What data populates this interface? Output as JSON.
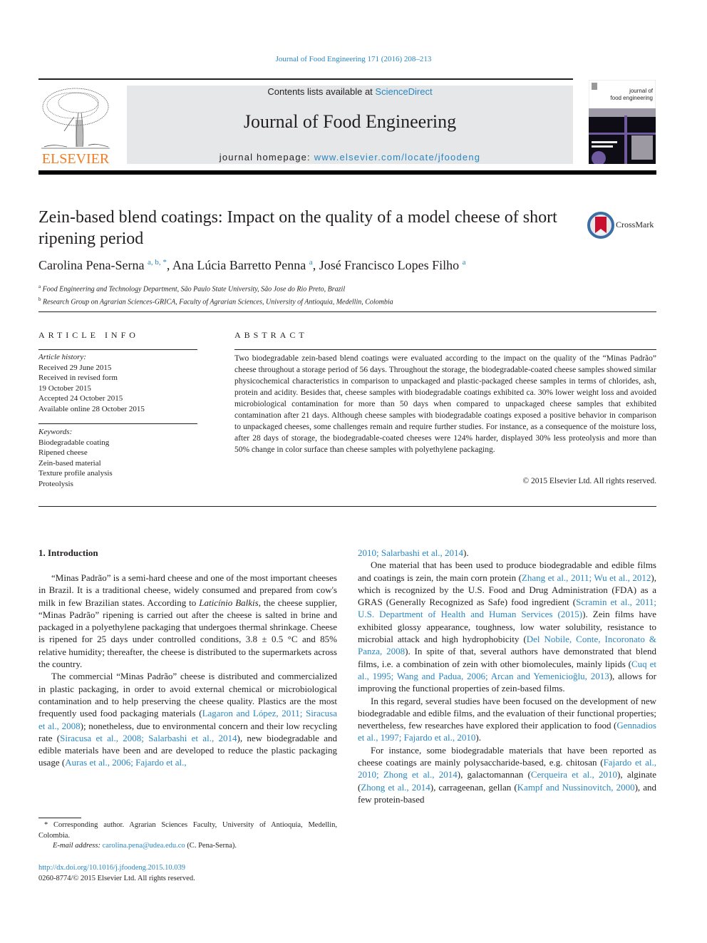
{
  "header": {
    "journal_ref": "Journal of Food Engineering 171 (2016) 208–213",
    "contents_prefix": "Contents lists available at ",
    "contents_link": "ScienceDirect",
    "journal_title": "Journal of Food Engineering",
    "homepage_prefix": "journal homepage: ",
    "homepage_link": "www.elsevier.com/locate/jfoodeng",
    "publisher_logo_text": "ELSEVIER",
    "cover_title_line1": "journal of",
    "cover_title_line2": "food engineering",
    "crossmark_label": "CrossMark"
  },
  "colors": {
    "link": "#2a86c0",
    "elsevier_orange": "#f47b20",
    "header_box": "#e6e7e8",
    "text": "#231f20"
  },
  "article": {
    "title": "Zein-based blend coatings: Impact on the quality of a model cheese of short ripening period",
    "authors": [
      {
        "name": "Carolina Pena-Serna",
        "marks": "a, b, *"
      },
      {
        "name": "Ana Lúcia Barretto Penna",
        "marks": "a"
      },
      {
        "name": "José Francisco Lopes Filho",
        "marks": "a"
      }
    ],
    "affiliations": [
      {
        "mark": "a",
        "text": "Food Engineering and Technology Department, São Paulo State University, São Jose do Rio Preto, Brazil"
      },
      {
        "mark": "b",
        "text": "Research Group on Agrarian Sciences-GRICA, Faculty of Agrarian Sciences, University of Antioquia, Medellin, Colombia"
      }
    ]
  },
  "article_info": {
    "heading": "ARTICLE INFO",
    "history_label": "Article history:",
    "history": [
      "Received 29 June 2015",
      "Received in revised form",
      "19 October 2015",
      "Accepted 24 October 2015",
      "Available online 28 October 2015"
    ],
    "keywords_label": "Keywords:",
    "keywords": [
      "Biodegradable coating",
      "Ripened cheese",
      "Zein-based material",
      "Texture profile analysis",
      "Proteolysis"
    ]
  },
  "abstract": {
    "heading": "ABSTRACT",
    "text": "Two biodegradable zein-based blend coatings were evaluated according to the impact on the quality of the “Minas Padrão” cheese throughout a storage period of 56 days. Throughout the storage, the biodegradable-coated cheese samples showed similar physicochemical characteristics in comparison to unpackaged and plastic-packaged cheese samples in terms of chlorides, ash, protein and acidity. Besides that, cheese samples with biodegradable coatings exhibited ca. 30% lower weight loss and avoided microbiological contamination for more than 50 days when compared to unpackaged cheese samples that exhibited contamination after 21 days. Although cheese samples with biodegradable coatings exposed a positive behavior in comparison to unpackaged cheeses, some challenges remain and require further studies. For instance, as a consequence of the moisture loss, after 28 days of storage, the biodegradable-coated cheeses were 124% harder, displayed 30% less proteolysis and more than 50% change in color surface than cheese samples with polyethylene packaging.",
    "copyright": "© 2015 Elsevier Ltd. All rights reserved."
  },
  "body": {
    "section_heading": "1.  Introduction",
    "p1": [
      {
        "t": "“Minas Padrão” is a semi-hard cheese and one of the most important cheeses in Brazil. It is a traditional cheese, widely consumed and prepared from cow's milk in few Brazilian states. According to "
      },
      {
        "t": "Laticínio Balkis",
        "i": true
      },
      {
        "t": ", the cheese supplier, “Minas Padrão” ripening is carried out after the cheese is salted in brine and packaged in a polyethylene packaging that undergoes thermal shrinkage. Cheese is ripened for 25 days under controlled conditions, 3.8 ± 0.5 °C and 85% relative humidity; thereafter, the cheese is distributed to the supermarkets across the country."
      }
    ],
    "p2": [
      {
        "t": "The commercial “Minas Padrão” cheese is distributed and commercialized in plastic packaging, in order to avoid external chemical or microbiological contamination and to help preserving the cheese quality. Plastics are the most frequently used food packaging materials ("
      },
      {
        "t": "Lagaron and López, 2011; Siracusa et al., 2008",
        "l": true
      },
      {
        "t": "); nonetheless, due to environmental concern and their low recycling rate ("
      },
      {
        "t": "Siracusa et al., 2008; Salarbashi et al., 2014",
        "l": true
      },
      {
        "t": "), new biodegradable and edible materials have been and are developed to reduce the plastic packaging usage ("
      },
      {
        "t": "Auras et al., 2006; Fajardo et al., 2010; Salarbashi et al., 2014",
        "l": true
      },
      {
        "t": ")."
      }
    ],
    "p3": [
      {
        "t": "One material that has been used to produce biodegradable and edible films and coatings is zein, the main corn protein ("
      },
      {
        "t": "Zhang et al., 2011; Wu et al., 2012",
        "l": true
      },
      {
        "t": "), which is recognized by the U.S. Food and Drug Administration (FDA) as a GRAS (Generally Recognized as Safe) food ingredient ("
      },
      {
        "t": "Scramin et al., 2011; U.S. Department of Health and Human Services (2015)",
        "l": true
      },
      {
        "t": "). Zein films have exhibited glossy appearance, toughness, low water solubility, resistance to microbial attack and high hydrophobicity ("
      },
      {
        "t": "Del Nobile, Conte, Incoronato & Panza, 2008",
        "l": true
      },
      {
        "t": "). In spite of that, several authors have demonstrated that blend films, i.e. a combination of zein with other biomolecules, mainly lipids ("
      },
      {
        "t": "Cuq et al., 1995; Wang and Padua, 2006; Arcan and Yemenicioğlu, 2013",
        "l": true
      },
      {
        "t": "), allows for improving the functional properties of zein-based films."
      }
    ],
    "p4": [
      {
        "t": "In this regard, several studies have been focused on the development of new biodegradable and edible films, and the evaluation of their functional properties; nevertheless, few researches have explored their application to food ("
      },
      {
        "t": "Gennadios et al., 1997; Fajardo et al., 2010",
        "l": true
      },
      {
        "t": ")."
      }
    ],
    "p5": [
      {
        "t": "For instance, some biodegradable materials that have been reported as cheese coatings are mainly polysaccharide-based, e.g. chitosan ("
      },
      {
        "t": "Fajardo et al., 2010; Zhong et al., 2014",
        "l": true
      },
      {
        "t": "), galactomannan ("
      },
      {
        "t": "Cerqueira et al., 2010",
        "l": true
      },
      {
        "t": "), alginate ("
      },
      {
        "t": "Zhong et al., 2014",
        "l": true
      },
      {
        "t": "), carrageenan, gellan ("
      },
      {
        "t": "Kampf and Nussinovitch, 2000",
        "l": true
      },
      {
        "t": "), and few protein-based"
      }
    ]
  },
  "footnotes": {
    "corresponding": "* Corresponding author. Agrarian Sciences Faculty, University of Antioquia, Medellin, Colombia.",
    "email_label": "E-mail address: ",
    "email": "carolina.pena@udea.edu.co",
    "email_suffix": " (C. Pena-Serna).",
    "doi": "http://dx.doi.org/10.1016/j.jfoodeng.2015.10.039",
    "issn": "0260-8774/© 2015 Elsevier Ltd. All rights reserved."
  }
}
